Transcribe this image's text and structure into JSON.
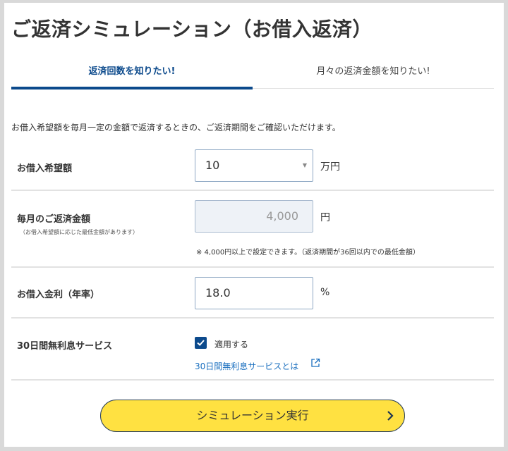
{
  "page": {
    "title": "ご返済シミュレーション（お借入返済）",
    "intro": "お借入希望額を毎月一定の金額で返済するときの、ご返済期間をご確認いただけます。"
  },
  "tabs": [
    {
      "label": "返済回数を知りたい!",
      "active": true
    },
    {
      "label": "月々の返済金額を知りたい!",
      "active": false
    }
  ],
  "form": {
    "loan_amount": {
      "label": "お借入希望額",
      "value": "10",
      "unit": "万円",
      "icon": "caret-down-icon"
    },
    "monthly_payment": {
      "label": "毎月のご返済金額",
      "sublabel": "（お借入希望額に応じた最低金額があります）",
      "value": "4,000",
      "unit": "円",
      "note": "※ 4,000円以上で設定できます。（返済期間が36回以内での最低金額）"
    },
    "interest_rate": {
      "label": "お借入金利（年率）",
      "value": "18.0",
      "unit": "%"
    },
    "interest_free": {
      "label": "30日間無利息サービス",
      "checkbox_label": "適用する",
      "checked": true,
      "link_text": "30日間無利息サービスとは",
      "link_icon": "external-link-icon"
    }
  },
  "submit": {
    "label": "シミュレーション実行",
    "icon": "chevron-right-icon"
  },
  "colors": {
    "accent": "#0c4a8c",
    "button": "#ffe141",
    "link": "#1a6fbf"
  }
}
